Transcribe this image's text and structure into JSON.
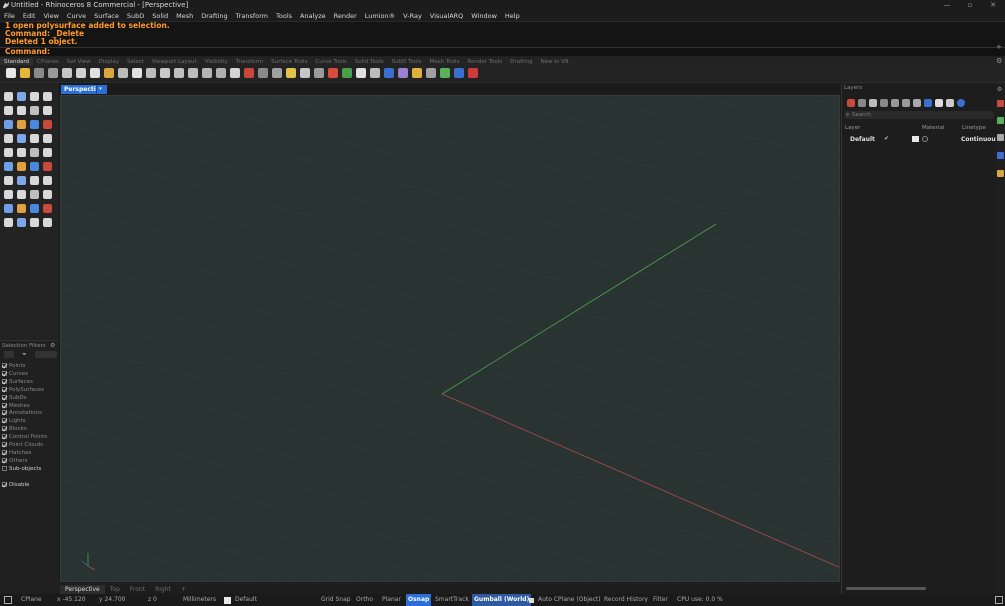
{
  "window": {
    "title": "Untitled - Rhinoceros 8 Commercial - [Perspective]",
    "controls": [
      "—",
      "▫",
      "✕"
    ]
  },
  "menu": [
    "File",
    "Edit",
    "View",
    "Curve",
    "Surface",
    "SubD",
    "Solid",
    "Mesh",
    "Drafting",
    "Transform",
    "Tools",
    "Analyze",
    "Render",
    "Lumion®",
    "V-Ray",
    "VisualARQ",
    "Window",
    "Help"
  ],
  "command_history": [
    "1 open polysurface added to selection.",
    "Command: _Delete",
    "Deleted 1 object.",
    "Command:"
  ],
  "toolbar_tabs": {
    "active": "Standard",
    "tabs": [
      "Standard",
      "CPlanes",
      "Set View",
      "Display",
      "Select",
      "Viewport Layout",
      "Visibility",
      "Transform",
      "Surface Tools",
      "Curve Tools",
      "Solid Tools",
      "SubD Tools",
      "Mesh Tools",
      "Render Tools",
      "Drafting",
      "New in V8"
    ]
  },
  "viewport": {
    "name": "Perspective",
    "dropdown_icon": "▾"
  },
  "viewport_tabs": {
    "tabs": [
      "Perspective",
      "Top",
      "Front",
      "Right"
    ],
    "add_label": "+"
  },
  "selection_filters": {
    "title": "Selection Filters",
    "items": [
      {
        "label": "Points",
        "checked": true
      },
      {
        "label": "Curves",
        "checked": true
      },
      {
        "label": "Surfaces",
        "checked": true
      },
      {
        "label": "PolySurfaces",
        "checked": true
      },
      {
        "label": "SubDs",
        "checked": true
      },
      {
        "label": "Meshes",
        "checked": true
      },
      {
        "label": "Annotations",
        "checked": true
      },
      {
        "label": "Lights",
        "checked": true
      },
      {
        "label": "Blocks",
        "checked": true
      },
      {
        "label": "Control Points",
        "checked": true
      },
      {
        "label": "Point Clouds",
        "checked": true
      },
      {
        "label": "Hatches",
        "checked": true
      },
      {
        "label": "Others",
        "checked": true
      },
      {
        "label": "Sub-objects",
        "checked": false
      }
    ],
    "disable_label": "Disable"
  },
  "layers": {
    "title": "Layers",
    "search_placeholder": "Search",
    "columns": {
      "layer": "Layer",
      "material": "Material",
      "linetype": "Linetype"
    },
    "rows": [
      {
        "name": "Default",
        "linetype": "Continuous"
      }
    ]
  },
  "status": {
    "cplane": "CPlane",
    "x": "x -45.120",
    "y": "y 24.700",
    "z": "z 0",
    "units": "Millimeters",
    "layer": "Default",
    "grid_snap": "Grid Snap",
    "ortho": "Ortho",
    "planar": "Planar",
    "osnap": "Osnap",
    "smarttrack": "SmartTrack",
    "gumball": "Gumball (World)",
    "auto_cplane": "Auto CPlane (Object)",
    "record_history": "Record History",
    "filter": "Filter",
    "cpu": "CPU use: 0.0 %"
  },
  "colors": {
    "accent": "#2a6fd6",
    "command_text": "#ff9a2a",
    "viewport_bg": "#283332",
    "x_axis": "#b34a4a",
    "y_axis": "#4fa34f"
  }
}
